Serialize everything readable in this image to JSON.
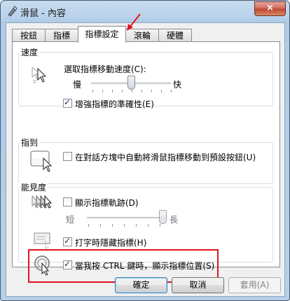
{
  "window": {
    "title": "滑鼠 - 內容",
    "close_label": "×"
  },
  "tabs": [
    {
      "label": "按鈕",
      "active": false
    },
    {
      "label": "指標",
      "active": false
    },
    {
      "label": "指標設定",
      "active": true
    },
    {
      "label": "滾輪",
      "active": false
    },
    {
      "label": "硬體",
      "active": false
    }
  ],
  "motion": {
    "group_label": "速度",
    "speed_label": "選取指標移動速度(C):",
    "slow_label": "慢",
    "fast_label": "快",
    "speed_value": 0.5,
    "enhance_label": "增強指標的準確性(E)",
    "enhance_checked": true
  },
  "snap_to": {
    "group_label": "指到",
    "snap_label": "在對話方塊中自動將滑鼠指標移動到預設按鈕(U)",
    "snap_checked": false
  },
  "visibility": {
    "group_label": "能見度",
    "trails_label": "顯示指標軌跡(D)",
    "trails_checked": false,
    "short_label": "短",
    "long_label": "長",
    "trails_value": 1.0,
    "hide_label": "打字時隱藏指標(H)",
    "hide_checked": true,
    "ctrl_label": "當我按 CTRL 鍵時，顯示指標位置(S)",
    "ctrl_checked": true
  },
  "buttons": {
    "ok": "確定",
    "cancel": "取消",
    "apply": "套用(A)"
  },
  "colors": {
    "highlight": "#e0141e",
    "accent": "#3c7fb1"
  }
}
